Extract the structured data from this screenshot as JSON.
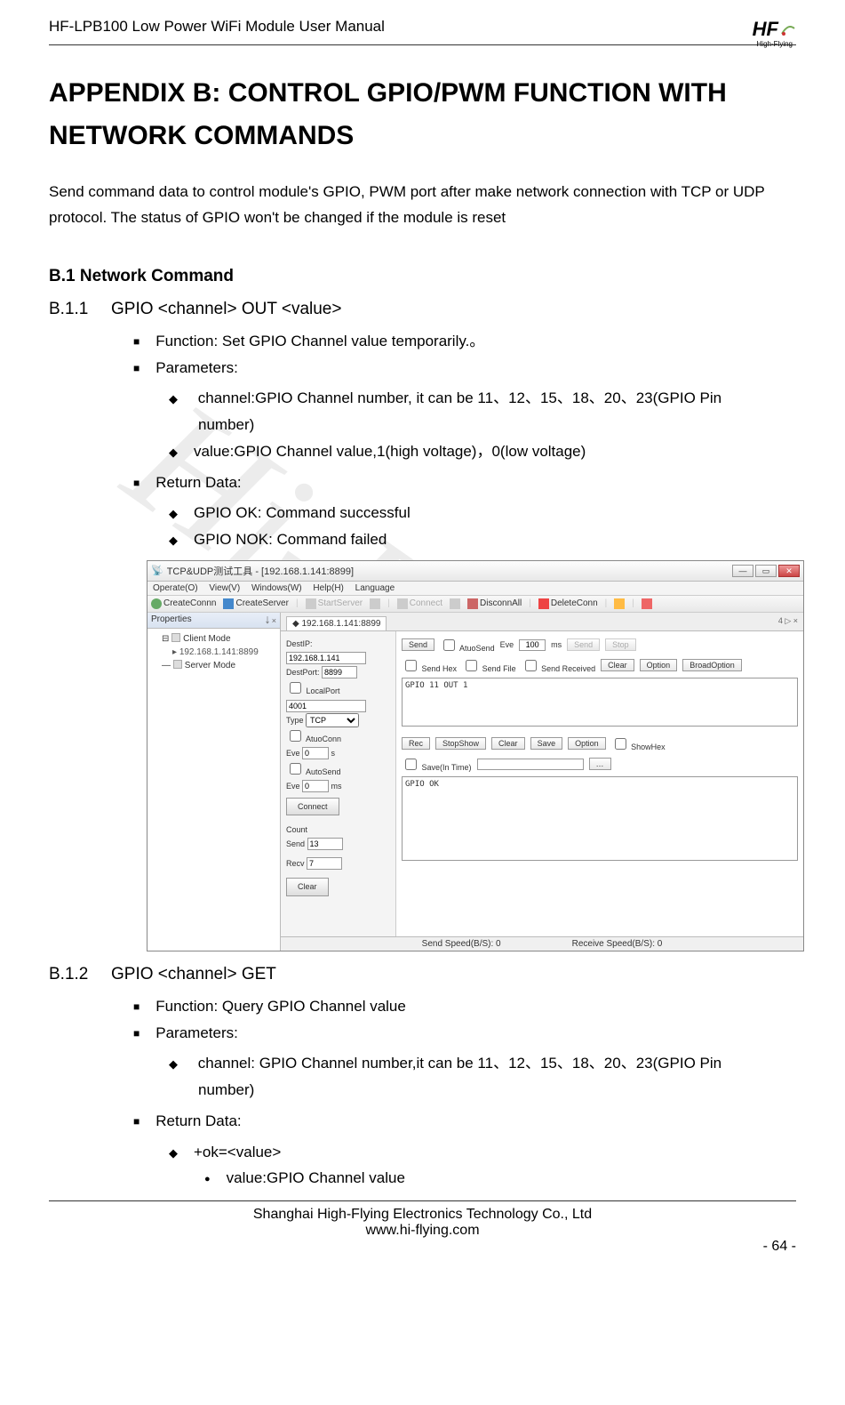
{
  "header": {
    "title": "HF-LPB100 Low Power WiFi Module User Manual",
    "logo_text": "HF",
    "logo_sub": "High-Flying"
  },
  "watermark": "Hi-Flying",
  "main_heading": "APPENDIX B: CONTROL GPIO/PWM FUNCTION WITH NETWORK COMMANDS",
  "intro": "Send command data to control module's GPIO, PWM port after make network connection with TCP or UDP protocol. The status of GPIO won't be changed if the module is reset",
  "section_b1": {
    "num": "B.1",
    "title": "Network Command"
  },
  "b11": {
    "num": "B.1.1",
    "title": "GPIO <channel> OUT <value>",
    "function": "Function: Set GPIO Channel value temporarily.。",
    "params_label": "Parameters:",
    "param_channel": "channel:GPIO Channel number, it can be 11、12、15、18、20、23(GPIO Pin",
    "param_channel_cont": "number)",
    "param_value": "value:GPIO Channel value,1(high voltage)，0(low voltage)",
    "return_label": "Return Data:",
    "ret_ok": "GPIO OK: Command successful",
    "ret_nok": "GPIO NOK: Command failed"
  },
  "b12": {
    "num": "B.1.2",
    "title": "GPIO <channel> GET",
    "function": "Function: Query GPIO Channel value",
    "params_label": "Parameters:",
    "param_channel": "channel: GPIO Channel number,it can be 11、12、15、18、20、23(GPIO Pin",
    "param_channel_cont": "number)",
    "return_label": "Return Data:",
    "ret_ok": "+ok=<value>",
    "ret_value": "value:GPIO Channel value"
  },
  "app": {
    "title": "TCP&UDP测试工具 - [192.168.1.141:8899]",
    "menu": {
      "operate": "Operate(O)",
      "view": "View(V)",
      "windows": "Windows(W)",
      "help": "Help(H)",
      "language": "Language"
    },
    "toolbar": {
      "createconn": "CreateConnn",
      "createserver": "CreateServer",
      "startserver": "StartServer",
      "connect": "Connect",
      "disconnall": "DisconnAll",
      "deleteconn": "DeleteConn"
    },
    "left": {
      "title": "Properties",
      "client_mode": "Client Mode",
      "conn_ip": "192.168.1.141:8899",
      "server_mode": "Server Mode"
    },
    "tab": "192.168.1.141:8899",
    "tab_nav": "4 ▷ ×",
    "conn": {
      "destip_label": "DestIP:",
      "destip": "192.168.1.141",
      "destport_label": "DestPort:",
      "destport": "8899",
      "localport_cb": "LocalPort",
      "localport": "4001",
      "type_label": "Type",
      "type": "TCP",
      "atuoconn_cb": "AtuoConn",
      "eve1_label": "Eve",
      "eve1_val": "0",
      "eve1_unit": "s",
      "autosend_cb": "AutoSend",
      "eve2_label": "Eve",
      "eve2_val": "0",
      "eve2_unit": "ms",
      "connect_btn": "Connect",
      "count_label": "Count",
      "send_label": "Send",
      "send_count": "13",
      "recv_label": "Recv",
      "recv_count": "7",
      "clear_btn": "Clear"
    },
    "send": {
      "btn": "Send",
      "atuosend_cb": "AtuoSend",
      "eve_label": "Eve",
      "eve_val": "100",
      "eve_unit": "ms",
      "send2_btn": "Send",
      "stop_btn": "Stop",
      "sendhex_cb": "Send Hex",
      "sendfile_cb": "Send File",
      "sendrecv_cb": "Send Received",
      "clear_btn": "Clear",
      "option_btn": "Option",
      "broad_btn": "BroadOption",
      "content": "GPIO 11 OUT 1"
    },
    "recv": {
      "label": "Rec",
      "stopshow_btn": "StopShow",
      "clear_btn": "Clear",
      "save_btn": "Save",
      "option_btn": "Option",
      "showhex_cb": "ShowHex",
      "saveintime_cb": "Save(In Time)",
      "content": "GPIO OK"
    },
    "status": {
      "send": "Send Speed(B/S): 0",
      "recv": "Receive Speed(B/S): 0"
    }
  },
  "footer": {
    "line1": "Shanghai High-Flying Electronics Technology Co., Ltd",
    "line2": "www.hi-flying.com",
    "page": "- 64 -"
  }
}
